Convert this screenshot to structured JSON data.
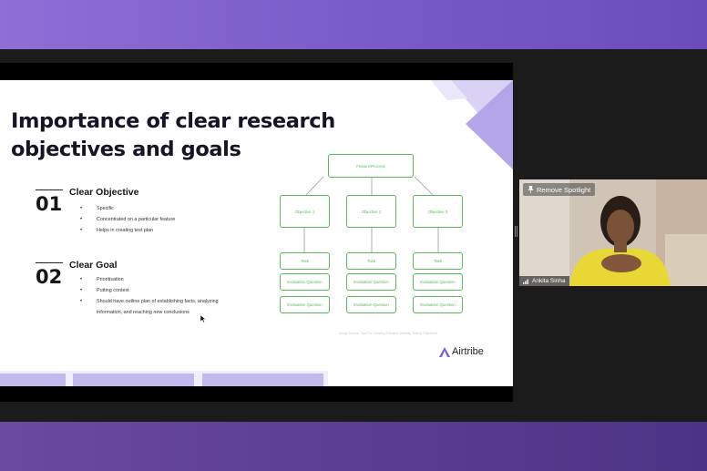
{
  "slide": {
    "title": "Importance of clear research\nobjectives and goals",
    "sections": [
      {
        "number": "01",
        "heading": "Clear Objective",
        "bullets": [
          "Specific",
          "Concentrated on a particular feature",
          "Helps in creating test plan"
        ]
      },
      {
        "number": "02",
        "heading": "Clear Goal",
        "bullets": [
          "Prioritisation",
          "Putting context",
          "Should have outline plan of establishing facts, analyzing",
          "information, and reaching new conclusions"
        ]
      }
    ],
    "diagram": {
      "root": "Feature/Process",
      "objectives": [
        "Objective 1",
        "Objective 2",
        "Objective 3"
      ],
      "task": "Task",
      "evaluation": "Evaluation Question"
    },
    "caption": "Image Source: Tips For Creating Effective Usability Testing Objectives",
    "brand": "Airtribe",
    "accent_color": "#5cb85c",
    "deco_color": "#b3a6e8"
  },
  "participant": {
    "spotlight_button": "Remove Spotlight",
    "name": "Ankita Sinha",
    "spotlight_icon": "pin-icon",
    "signal_icon": "signal-bars-icon"
  },
  "colors": {
    "top_band": "#8f6fd6",
    "bottom_band": "#5b3e92",
    "meeting_bg": "#1b1b1b"
  }
}
